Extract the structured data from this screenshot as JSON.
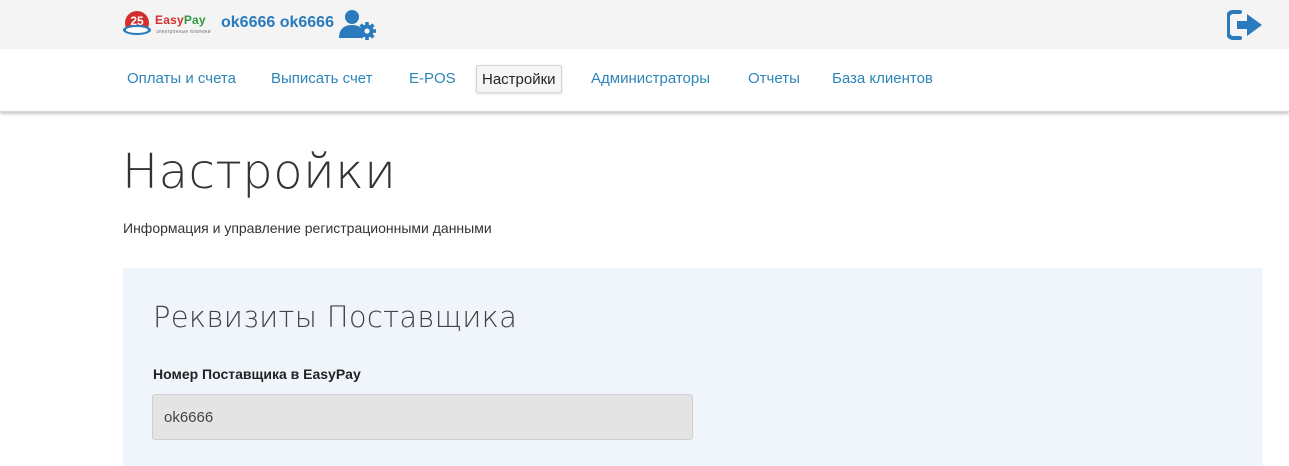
{
  "brand": {
    "badge_number": "25",
    "word_easy": "Easy",
    "word_pay": "Pay",
    "tagline": "электронные платежи",
    "logo_icon": "easypay-logo"
  },
  "header": {
    "user_name": "ok6666 ok6666",
    "user_settings_icon": "user-gear-icon",
    "logout_icon": "sign-out-icon"
  },
  "nav": {
    "items": [
      {
        "label": "Оплаты и счета",
        "active": false
      },
      {
        "label": "Выписать счет",
        "active": false
      },
      {
        "label": "E-POS",
        "active": false
      },
      {
        "label": "Настройки",
        "active": true
      },
      {
        "label": "Администраторы",
        "active": false
      },
      {
        "label": "Отчеты",
        "active": false
      },
      {
        "label": "База клиентов",
        "active": false
      }
    ]
  },
  "page": {
    "title": "Настройки",
    "subtitle": "Информация и управление регистрационными данными"
  },
  "panel": {
    "title": "Реквизиты Поставщика",
    "field_label": "Номер Поставщика в EasyPay",
    "field_value": "ok6666"
  },
  "colors": {
    "link": "#2d86b8",
    "user": "#2a7bbd",
    "topbar_bg": "#f3f4f3",
    "panel_bg": "#f0f4fb",
    "input_bg": "#e4e4e4"
  }
}
